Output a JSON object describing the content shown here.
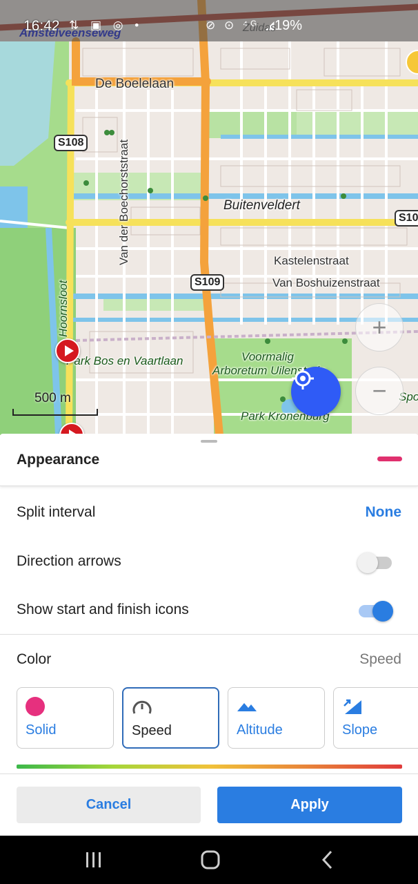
{
  "status_bar": {
    "time": "16:42",
    "icons_left": "⇅ ▣ ◎ •",
    "icons_right": "⊘ ⊙ ⁴ᴳ ◢",
    "battery": "19%"
  },
  "map": {
    "labels": {
      "amstelveenseweg": "Amstelveenseweg",
      "zuidas": "Zuidas",
      "de_boelelaan": "De Boelelaan",
      "s108": "S108",
      "van_der_boechorststraat": "Van der Boechorststraat",
      "buitenveldert": "Buitenveldert",
      "s10": "S10",
      "kastelenstraat": "Kastelenstraat",
      "s109": "S109",
      "van_boshuizenstraat": "Van Boshuizenstraat",
      "hoornsloot": "Hoornsloot",
      "park_bos_en_vaartlaan": "Park Bos en Vaartlaan",
      "voormalig": "Voormalig",
      "arboretum_uilenstede": "Arboretum Uilenstede",
      "park_kronenburg": "Park Kronenburg",
      "spo": "Spo"
    },
    "scale": "500 m",
    "zoom_in_symbol": "+",
    "zoom_out_symbol": "−",
    "colors": {
      "road_primary": "#f4a23c",
      "road_secondary": "#f6e15a",
      "water": "#a8d8f0",
      "park": "#a6dc8c",
      "land": "#efe9e4",
      "locate_button": "#2f5bf6"
    }
  },
  "sheet": {
    "title": "Appearance",
    "accent_color": "#e0306e",
    "split_interval": {
      "label": "Split interval",
      "value": "None"
    },
    "direction_arrows": {
      "label": "Direction arrows",
      "enabled": false
    },
    "start_finish_icons": {
      "label": "Show start and finish icons",
      "enabled": true
    },
    "color": {
      "label": "Color",
      "value": "Speed",
      "options": [
        {
          "label": "Solid",
          "icon": "solid-dot-icon",
          "selected": false
        },
        {
          "label": "Speed",
          "icon": "speedometer-icon",
          "selected": true
        },
        {
          "label": "Altitude",
          "icon": "mountains-icon",
          "selected": false
        },
        {
          "label": "Slope",
          "icon": "slope-icon",
          "selected": false
        }
      ]
    },
    "buttons": {
      "cancel": "Cancel",
      "apply": "Apply"
    }
  },
  "nav_bar": {
    "recents_icon": "recents-icon",
    "home_icon": "home-icon",
    "back_icon": "back-icon"
  }
}
